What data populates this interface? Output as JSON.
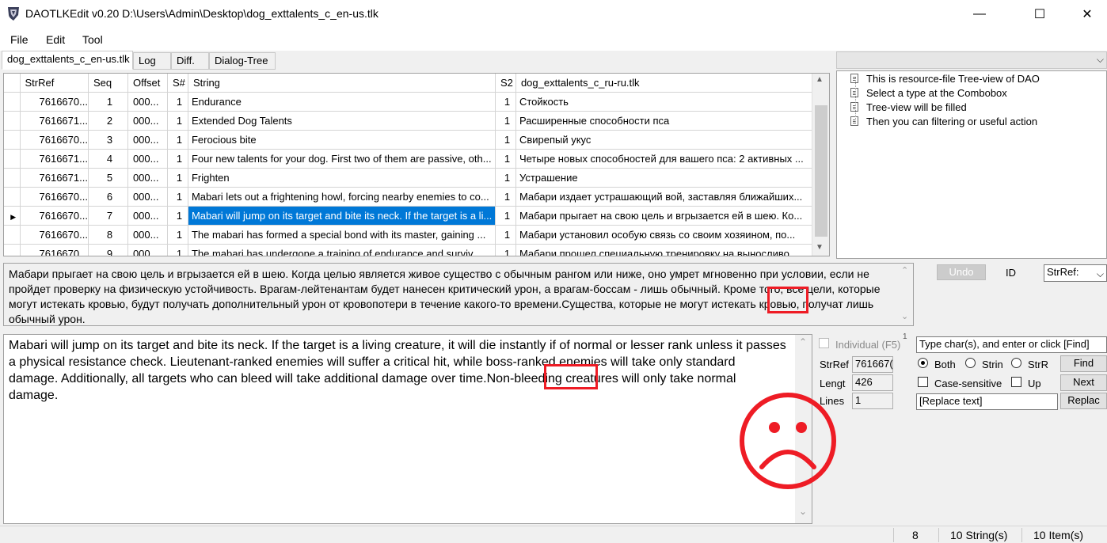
{
  "window": {
    "title": "DAOTLKEdit v0.20 D:\\Users\\Admin\\Desktop\\dog_exttalents_c_en-us.tlk",
    "minimize": "—",
    "maximize": "☐",
    "close": "✕"
  },
  "menu": [
    "File",
    "Edit",
    "Tool"
  ],
  "tabs": [
    "dog_exttalents_c_en-us.tlk",
    "Log",
    "Diff.",
    "Dialog-Tree"
  ],
  "grid": {
    "columns": [
      "StrRef",
      "Seq",
      "Offset",
      "S#",
      "String",
      "S2",
      "dog_exttalents_c_ru-ru.tlk"
    ],
    "rows": [
      {
        "strref": "7616670...",
        "seq": "1",
        "offset": "000...",
        "s": "1",
        "string": "Endurance",
        "s2": "1",
        "ru": "Стойкость"
      },
      {
        "strref": "7616671...",
        "seq": "2",
        "offset": "000...",
        "s": "1",
        "string": "Extended Dog Talents",
        "s2": "1",
        "ru": "Расширенные способности пса"
      },
      {
        "strref": "7616670...",
        "seq": "3",
        "offset": "000...",
        "s": "1",
        "string": "Ferocious bite",
        "s2": "1",
        "ru": "Свирепый укус"
      },
      {
        "strref": "7616671...",
        "seq": "4",
        "offset": "000...",
        "s": "1",
        "string": "Four new talents for your dog. First two of them are passive, oth...",
        "s2": "1",
        "ru": "Четыре новых способностей для вашего пса: 2 активных ..."
      },
      {
        "strref": "7616671...",
        "seq": "5",
        "offset": "000...",
        "s": "1",
        "string": "Frighten",
        "s2": "1",
        "ru": "Устрашение"
      },
      {
        "strref": "7616670...",
        "seq": "6",
        "offset": "000...",
        "s": "1",
        "string": "Mabari lets out a frightening howl, forcing nearby enemies to co...",
        "s2": "1",
        "ru": "Мабари издает устрашающий вой, заставляя ближайших..."
      },
      {
        "strref": "7616670...",
        "seq": "7",
        "offset": "000...",
        "s": "1",
        "string": "Mabari will jump on its target and bite its neck. If the target is a li...",
        "s2": "1",
        "ru": "Мабари прыгает на свою цель и вгрызается ей в шею. Ко..."
      },
      {
        "strref": "7616670...",
        "seq": "8",
        "offset": "000...",
        "s": "1",
        "string": "The mabari has formed a special bond with its master, gaining ...",
        "s2": "1",
        "ru": "Мабари установил особую связь со своим хозяином, по..."
      },
      {
        "strref": "7616670...",
        "seq": "9",
        "offset": "000...",
        "s": "1",
        "string": "The mabari has undergone a training of endurance and surviv...",
        "s2": "1",
        "ru": "Мабари прошел специальную тренировку на выносливо..."
      }
    ]
  },
  "tree": {
    "items": [
      "This is resource-file Tree-view of DAO",
      "Select a type at the Combobox",
      "Tree-view will be filled",
      "Then you can filtering or useful action"
    ]
  },
  "ru_text": "Мабари прыгает на свою цель и вгрызается ей в шею. Когда целью является живое существо с обычным рангом или ниже, оно умрет мгновенно при условии, если не пройдет проверку на физическую устойчивость. Врагам-лейтенантам будет нанесен критический урон, а врагам-боссам - лишь обычный. Кроме того, все цели, которые могут истекать кровью, будут получать дополнительный урон от кровопотери в течение какого-то времени.Существа, которые не могут истекать кровью, получат лишь обычный урон.",
  "en_text": "Mabari will jump on its target and bite its neck. If the target is a living creature, it will die instantly if of normal or lesser rank unless it passes a physical resistance check. Lieutenant-ranked enemies will suffer a critical hit, while boss-ranked enemies will take only standard damage. Additionally, all targets who can bleed will take additional damage over time.Non-bleeding creatures will only take normal damage.",
  "controls": {
    "undo": "Undo",
    "id_label": "ID",
    "id_combo": "StrRef:",
    "individual": "Individual (F5)",
    "search_placeholder": "Type char(s), and enter or click [Find]",
    "small_one": "1",
    "strref_label": "StrRef",
    "strref_value": "761667(",
    "length_label": "Lengt",
    "length_value": "426",
    "lines_label": "Lines",
    "lines_value": "1",
    "radio_both": "Both",
    "radio_strin": "Strin",
    "radio_strr": "StrR",
    "case_sensitive": "Case-sensitive",
    "up": "Up",
    "find": "Find",
    "next": "Next",
    "replace_placeholder": "[Replace text]",
    "replace": "Replac"
  },
  "status": {
    "current": "8",
    "strings": "10 String(s)",
    "items": "10 Item(s)"
  },
  "colors": {
    "selection": "#0078d7",
    "annotation_red": "#ee1c25"
  },
  "icons": {
    "row_pointer": "triangle-right",
    "sad_face": "frowning-face"
  }
}
